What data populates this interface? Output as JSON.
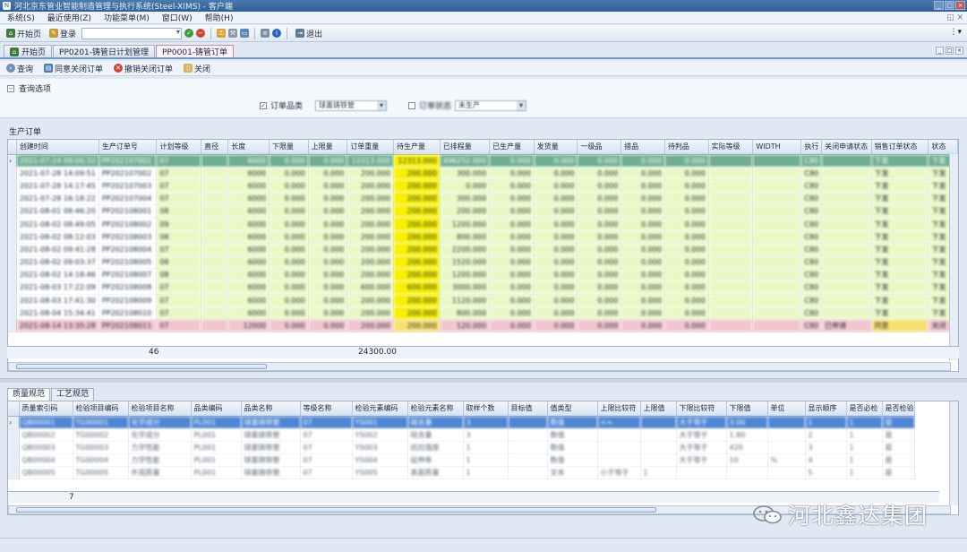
{
  "window": {
    "title": "河北京东管业智能制造管理与执行系统(Steel-XIMS) - 客户端"
  },
  "menu": [
    "系统(S)",
    "最近使用(Z)",
    "功能菜单(M)",
    "窗口(W)",
    "帮助(H)"
  ],
  "toolbar": {
    "home_label": "开始页",
    "login_label": "登录",
    "exit_label": "退出"
  },
  "doc_tabs": [
    "开始页",
    "PP0201-铸管日计划管理",
    "PP0001-铸管订单"
  ],
  "actions": {
    "query": "查询",
    "agree_close": "同意关闭订单",
    "revoke_close": "撤销关闭订单",
    "close": "关闭"
  },
  "query_panel": {
    "title": "查询选项",
    "f1_label": "订单品类",
    "f1_value": "球墨铸铁管",
    "f2_label": "订单状态",
    "f2_value": "未生产"
  },
  "grid1": {
    "title": "生产订单",
    "columns": [
      "创建时间",
      "生产订单号",
      "计划等级",
      "直径",
      "长度",
      "下限量",
      "上限量",
      "订单重量",
      "待生产量",
      "已排程量",
      "已生产量",
      "发货量",
      "一级品",
      "搭品",
      "待判品",
      "实际等级",
      "WIDTH",
      "执行",
      "关闭申请状态",
      "销售订单状态",
      "状态"
    ],
    "rows": [
      [
        "2021-07-24 09:06:32",
        "PP202107001",
        "07",
        "",
        "6000",
        "0.000",
        "0.000",
        "12313.000",
        "12313.000",
        "496252.000",
        "0.000",
        "0.000",
        "0.000",
        "0.000",
        "0.000",
        "",
        "",
        "C80",
        "",
        "下发",
        "下发"
      ],
      [
        "2021-07-28 14:09:51",
        "PP202107002",
        "07",
        "",
        "6000",
        "0.000",
        "0.000",
        "200.000",
        "200.000",
        "300.000",
        "0.000",
        "0.000",
        "0.000",
        "0.000",
        "0.000",
        "",
        "",
        "C80",
        "",
        "下发",
        "下发"
      ],
      [
        "2021-07-28 14:17:45",
        "PP202107003",
        "07",
        "",
        "6000",
        "0.000",
        "0.000",
        "200.000",
        "200.000",
        "0.000",
        "0.000",
        "0.000",
        "0.000",
        "0.000",
        "0.000",
        "",
        "",
        "C80",
        "",
        "下发",
        "下发"
      ],
      [
        "2021-07-28 16:18:22",
        "PP202107004",
        "07",
        "",
        "6000",
        "0.000",
        "0.000",
        "200.000",
        "200.000",
        "300.000",
        "0.000",
        "0.000",
        "0.000",
        "0.000",
        "0.000",
        "",
        "",
        "C80",
        "",
        "下发",
        "下发"
      ],
      [
        "2021-08-01 08:46:20",
        "PP202108001",
        "08",
        "",
        "6000",
        "0.000",
        "0.000",
        "200.000",
        "200.000",
        "200.000",
        "0.000",
        "0.000",
        "0.000",
        "0.000",
        "0.000",
        "",
        "",
        "C80",
        "",
        "下发",
        "下发"
      ],
      [
        "2021-08-02 08:49:05",
        "PP202108002",
        "09",
        "",
        "6000",
        "0.000",
        "0.000",
        "200.000",
        "200.000",
        "1200.000",
        "0.000",
        "0.000",
        "0.000",
        "0.000",
        "0.000",
        "",
        "",
        "C80",
        "",
        "下发",
        "下发"
      ],
      [
        "2021-08-02 08:12:03",
        "PP202108003",
        "08",
        "",
        "6000",
        "0.000",
        "0.000",
        "200.000",
        "200.000",
        "800.000",
        "0.000",
        "0.000",
        "0.000",
        "0.000",
        "0.000",
        "",
        "",
        "C80",
        "",
        "下发",
        "下发"
      ],
      [
        "2021-08-02 09:41:28",
        "PP202108004",
        "07",
        "",
        "6000",
        "0.000",
        "0.000",
        "200.000",
        "200.000",
        "2200.000",
        "0.000",
        "0.000",
        "0.000",
        "0.000",
        "0.000",
        "",
        "",
        "C80",
        "",
        "下发",
        "下发"
      ],
      [
        "2021-08-02 09:03:37",
        "PP202108005",
        "08",
        "",
        "6000",
        "0.000",
        "0.000",
        "200.000",
        "200.000",
        "1520.000",
        "0.000",
        "0.000",
        "0.000",
        "0.000",
        "0.000",
        "",
        "",
        "C80",
        "",
        "下发",
        "下发"
      ],
      [
        "2021-08-02 14:18:46",
        "PP202108007",
        "08",
        "",
        "6000",
        "0.000",
        "0.000",
        "200.000",
        "200.000",
        "1200.000",
        "0.000",
        "0.000",
        "0.000",
        "0.000",
        "0.000",
        "",
        "",
        "C80",
        "",
        "下发",
        "下发"
      ],
      [
        "2021-08-03 17:22:09",
        "PP202108008",
        "07",
        "",
        "6000",
        "0.000",
        "0.000",
        "600.000",
        "600.000",
        "3000.000",
        "0.000",
        "0.000",
        "0.000",
        "0.000",
        "0.000",
        "",
        "",
        "C80",
        "",
        "下发",
        "下发"
      ],
      [
        "2021-08-03 17:41:30",
        "PP202108009",
        "07",
        "",
        "6000",
        "0.000",
        "0.000",
        "200.000",
        "200.000",
        "1120.000",
        "0.000",
        "0.000",
        "0.000",
        "0.000",
        "0.000",
        "",
        "",
        "C80",
        "",
        "下发",
        "下发"
      ],
      [
        "2021-08-04 15:34:41",
        "PP202108010",
        "07",
        "",
        "6000",
        "0.000",
        "0.000",
        "200.000",
        "200.000",
        "800.000",
        "0.000",
        "0.000",
        "0.000",
        "0.000",
        "0.000",
        "",
        "",
        "C80",
        "",
        "下发",
        "下发"
      ],
      [
        "2021-08-14 13:35:28",
        "PP202108011",
        "07",
        "",
        "12000",
        "0.000",
        "0.000",
        "200.000",
        "200.000",
        "120.000",
        "0.000",
        "0.000",
        "0.000",
        "0.000",
        "0.000",
        "",
        "",
        "C80",
        "已申请",
        "同意",
        "关闭"
      ]
    ],
    "summary_count": "46",
    "summary_total": "24300.00"
  },
  "sub_tabs": [
    "质量规范",
    "工艺规范"
  ],
  "grid2": {
    "columns": [
      "质量索引码",
      "检验项目编码",
      "检验项目名称",
      "品类编码",
      "品类名称",
      "等级名称",
      "检验元素编码",
      "检验元素名称",
      "取样个数",
      "目标值",
      "值类型",
      "上限比较符",
      "上限值",
      "下限比较符",
      "下限值",
      "单位",
      "显示顺序",
      "是否必检",
      "是否检验"
    ],
    "rows": [
      [
        "QB00001",
        "TG00001",
        "化学成分",
        "PL001",
        "球墨铸铁管",
        "07",
        "YS001",
        "碳含量",
        "3",
        "",
        "数值",
        "<=",
        "",
        "大于等于",
        "3.00",
        "",
        "1",
        "1",
        "是"
      ],
      [
        "QB00002",
        "TG00002",
        "化学成分",
        "PL001",
        "球墨铸铁管",
        "07",
        "YS002",
        "硅含量",
        "3",
        "",
        "数值",
        "",
        "",
        "大于等于",
        "1.80",
        "",
        "2",
        "1",
        "是"
      ],
      [
        "QB00003",
        "TG00003",
        "力学性能",
        "PL001",
        "球墨铸铁管",
        "07",
        "YS003",
        "抗拉强度",
        "1",
        "",
        "数值",
        "",
        "",
        "大于等于",
        "420",
        "",
        "3",
        "1",
        "是"
      ],
      [
        "QB00004",
        "TG00004",
        "力学性能",
        "PL001",
        "球墨铸铁管",
        "07",
        "YS004",
        "延伸率",
        "1",
        "",
        "数值",
        "",
        "",
        "大于等于",
        "10",
        "%",
        "4",
        "1",
        "是"
      ],
      [
        "QB00005",
        "TG00005",
        "外观质量",
        "PL001",
        "球墨铸铁管",
        "07",
        "YS005",
        "表面质量",
        "1",
        "",
        "文本",
        "小于等于",
        "1",
        "",
        "",
        "",
        "5",
        "1",
        "是"
      ]
    ],
    "summary_count": "7"
  },
  "watermark": {
    "text": "河北鑫达集团"
  }
}
